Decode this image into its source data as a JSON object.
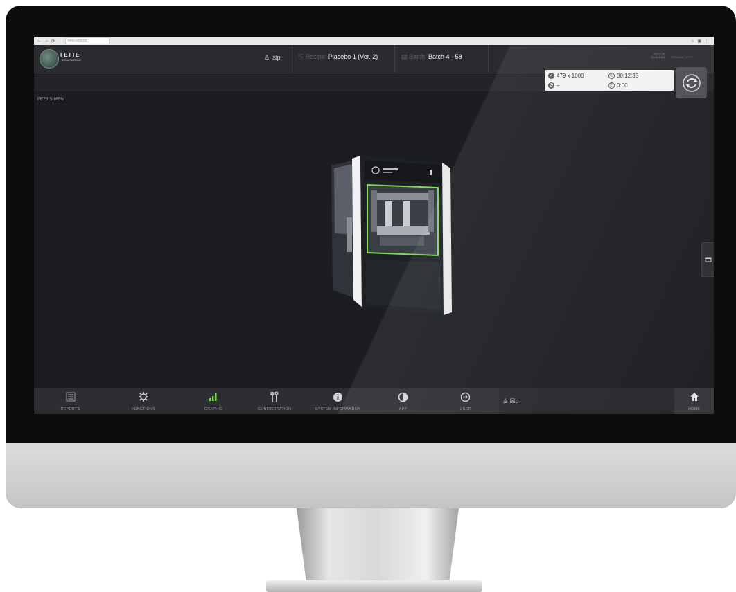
{
  "browser": {
    "url": "fette-simeon",
    "icons": [
      "star-icon",
      "extension-icon",
      "menu-icon"
    ]
  },
  "header": {
    "logo_text": "FETTE",
    "logo_sub": "COMPACTING",
    "user_badge": "♙ ☒p",
    "recipe_label": "Recipe:",
    "recipe_value": "Placebo 1 (Ver. 2)",
    "batch_label": "Batch:",
    "batch_value": "Batch 4 - 58",
    "clock_time": "09:17:35",
    "clock_date": "10.05.2016",
    "extra": "TERMINAL FETTE"
  },
  "status": {
    "count": "479 x 1000",
    "timer": "00:12:35",
    "row2_left": "–",
    "row2_right": "0:00"
  },
  "breadcrumb": "FE75 SIMEN",
  "toolbar": {
    "items": [
      {
        "label": "REPORTS",
        "icon": "reports-icon"
      },
      {
        "label": "FUNCTIONS",
        "icon": "gear-icon"
      },
      {
        "label": "GRAPHIC",
        "icon": "bar-chart-icon"
      },
      {
        "label": "CONFIGURATION",
        "icon": "tools-icon"
      },
      {
        "label": "SYSTEM INFORMATION",
        "icon": "info-icon"
      },
      {
        "label": "APP",
        "icon": "contrast-icon"
      },
      {
        "label": "USER",
        "icon": "logout-icon"
      }
    ],
    "user_badge": "♙ ☒p",
    "home_label": "HOME"
  },
  "colors": {
    "screen_bg": "#1c1d21",
    "header_bg": "#2a2b2f",
    "status_panel": "#f1f1f1",
    "accent_green": "#7ed957"
  }
}
